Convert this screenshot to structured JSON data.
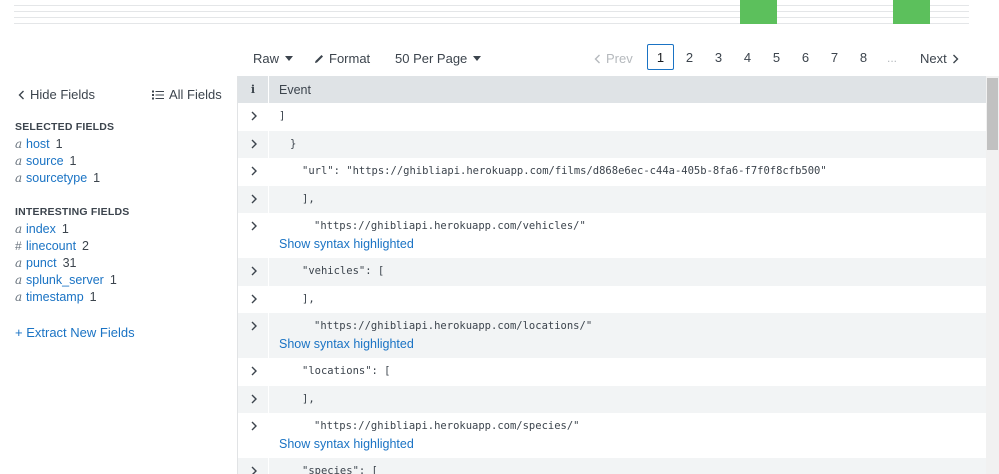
{
  "timeline": {
    "bar_color": "#5cc05c"
  },
  "toolbar": {
    "raw_label": "Raw",
    "format_label": "Format",
    "per_page_label": "50 Per Page",
    "prev_label": "Prev",
    "next_label": "Next",
    "pages": [
      "1",
      "2",
      "3",
      "4",
      "5",
      "6",
      "7",
      "8"
    ],
    "current_page": "1",
    "ellipsis": "..."
  },
  "sidebar": {
    "hide_fields_label": "Hide Fields",
    "all_fields_label": "All Fields",
    "selected_heading": "SELECTED FIELDS",
    "selected_fields": [
      {
        "type": "a",
        "name": "host",
        "count": "1"
      },
      {
        "type": "a",
        "name": "source",
        "count": "1"
      },
      {
        "type": "a",
        "name": "sourcetype",
        "count": "1"
      }
    ],
    "interesting_heading": "INTERESTING FIELDS",
    "interesting_fields": [
      {
        "type": "a",
        "name": "index",
        "count": "1"
      },
      {
        "type": "#",
        "name": "linecount",
        "count": "2"
      },
      {
        "type": "a",
        "name": "punct",
        "count": "31"
      },
      {
        "type": "a",
        "name": "splunk_server",
        "count": "1"
      },
      {
        "type": "a",
        "name": "timestamp",
        "count": "1"
      }
    ],
    "extract_label": "+ Extract New Fields"
  },
  "events": {
    "info_col": "i",
    "event_col": "Event",
    "syntax_link": "Show syntax highlighted",
    "rows": [
      {
        "text": "]",
        "indent": 0,
        "syntax": false
      },
      {
        "text": "}",
        "indent": 1,
        "syntax": false
      },
      {
        "text": "\"url\": \"https://ghibliapi.herokuapp.com/films/d868e6ec-c44a-405b-8fa6-f7f0f8cfb500\"",
        "indent": 2,
        "syntax": false
      },
      {
        "text": "],",
        "indent": 2,
        "syntax": false
      },
      {
        "text": "\"https://ghibliapi.herokuapp.com/vehicles/\"",
        "indent": 3,
        "syntax": true
      },
      {
        "text": "\"vehicles\": [",
        "indent": 2,
        "syntax": false
      },
      {
        "text": "],",
        "indent": 2,
        "syntax": false
      },
      {
        "text": "\"https://ghibliapi.herokuapp.com/locations/\"",
        "indent": 3,
        "syntax": true
      },
      {
        "text": "\"locations\": [",
        "indent": 2,
        "syntax": false
      },
      {
        "text": "],",
        "indent": 2,
        "syntax": false
      },
      {
        "text": "\"https://ghibliapi.herokuapp.com/species/\"",
        "indent": 3,
        "syntax": true
      },
      {
        "text": "\"species\": [",
        "indent": 2,
        "syntax": false
      }
    ]
  }
}
